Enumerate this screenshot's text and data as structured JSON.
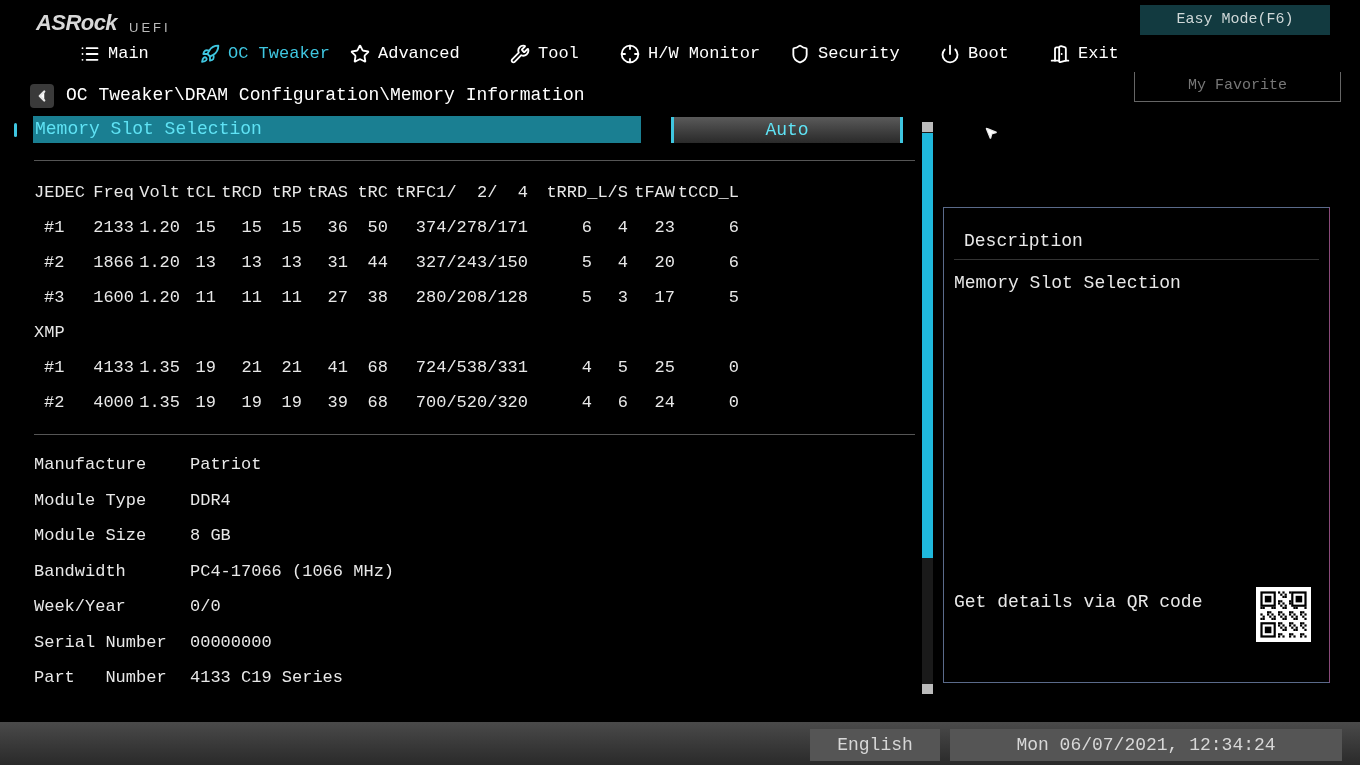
{
  "logo": {
    "brand": "ASRock",
    "suffix": "UEFI"
  },
  "easy_mode_button": "Easy Mode(F6)",
  "tabs": [
    {
      "label": "Main",
      "selected": false
    },
    {
      "label": "OC Tweaker",
      "selected": true
    },
    {
      "label": "Advanced",
      "selected": false
    },
    {
      "label": "Tool",
      "selected": false
    },
    {
      "label": "H/W Monitor",
      "selected": false
    },
    {
      "label": "Security",
      "selected": false
    },
    {
      "label": "Boot",
      "selected": false
    },
    {
      "label": "Exit",
      "selected": false
    }
  ],
  "my_favorite_button": "My Favorite",
  "breadcrumb": "OC Tweaker\\DRAM Configuration\\Memory Information",
  "setting": {
    "label": "Memory Slot Selection",
    "value": "Auto",
    "selected": true
  },
  "timing_table": {
    "columns": [
      "JEDEC",
      "Freq",
      "Volt",
      "tCL",
      "tRCD",
      "tRP",
      "tRAS",
      "tRC",
      "tRFC1/  2/  4",
      "tRRD_L/S",
      "tFAW",
      "tCCD_L"
    ],
    "rows": [
      {
        "kind": "data",
        "cells": [
          "#1",
          "2133",
          "1.20",
          "15",
          "15",
          "15",
          "36",
          "50",
          "374/278/171",
          "6",
          "4",
          "23",
          "6"
        ]
      },
      {
        "kind": "data",
        "cells": [
          "#2",
          "1866",
          "1.20",
          "13",
          "13",
          "13",
          "31",
          "44",
          "327/243/150",
          "5",
          "4",
          "20",
          "6"
        ]
      },
      {
        "kind": "data",
        "cells": [
          "#3",
          "1600",
          "1.20",
          "11",
          "11",
          "11",
          "27",
          "38",
          "280/208/128",
          "5",
          "3",
          "17",
          "5"
        ]
      },
      {
        "kind": "section",
        "label": "XMP"
      },
      {
        "kind": "data",
        "cells": [
          "#1",
          "4133",
          "1.35",
          "19",
          "21",
          "21",
          "41",
          "68",
          "724/538/331",
          "4",
          "5",
          "25",
          "0"
        ]
      },
      {
        "kind": "data",
        "cells": [
          "#2",
          "4000",
          "1.35",
          "19",
          "19",
          "19",
          "39",
          "68",
          "700/520/320",
          "4",
          "6",
          "24",
          "0"
        ]
      }
    ]
  },
  "info": [
    {
      "label": "Manufacture",
      "value": "Patriot"
    },
    {
      "label": "Module Type",
      "value": "DDR4"
    },
    {
      "label": "Module Size",
      "value": "8 GB"
    },
    {
      "label": "Bandwidth",
      "value": "PC4-17066 (1066 MHz)"
    },
    {
      "label": "Week/Year",
      "value": "0/0"
    },
    {
      "label": "Serial Number",
      "value": "00000000"
    },
    {
      "label": "Part   Number",
      "value": "4133 C19 Series"
    }
  ],
  "description": {
    "title": "Description",
    "text": "Memory Slot Selection",
    "qr_hint": "Get details via QR code"
  },
  "status_bar": {
    "language": "English",
    "datetime": "Mon 06/07/2021, 12:34:24"
  }
}
